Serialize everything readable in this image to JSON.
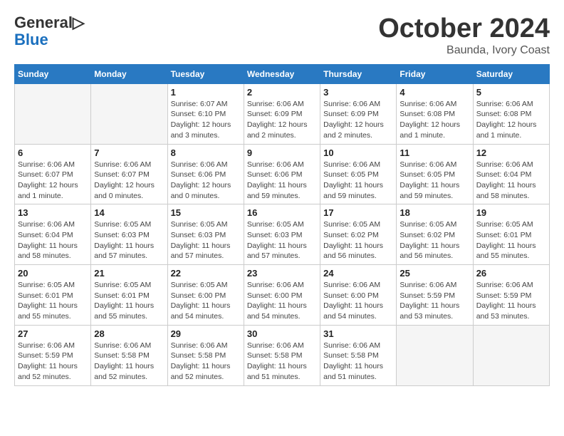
{
  "header": {
    "logo_general": "General",
    "logo_blue": "Blue",
    "month": "October 2024",
    "location": "Baunda, Ivory Coast"
  },
  "weekdays": [
    "Sunday",
    "Monday",
    "Tuesday",
    "Wednesday",
    "Thursday",
    "Friday",
    "Saturday"
  ],
  "weeks": [
    [
      {
        "day": "",
        "empty": true
      },
      {
        "day": "",
        "empty": true
      },
      {
        "day": "1",
        "sunrise": "Sunrise: 6:07 AM",
        "sunset": "Sunset: 6:10 PM",
        "daylight": "Daylight: 12 hours and 3 minutes."
      },
      {
        "day": "2",
        "sunrise": "Sunrise: 6:06 AM",
        "sunset": "Sunset: 6:09 PM",
        "daylight": "Daylight: 12 hours and 2 minutes."
      },
      {
        "day": "3",
        "sunrise": "Sunrise: 6:06 AM",
        "sunset": "Sunset: 6:09 PM",
        "daylight": "Daylight: 12 hours and 2 minutes."
      },
      {
        "day": "4",
        "sunrise": "Sunrise: 6:06 AM",
        "sunset": "Sunset: 6:08 PM",
        "daylight": "Daylight: 12 hours and 1 minute."
      },
      {
        "day": "5",
        "sunrise": "Sunrise: 6:06 AM",
        "sunset": "Sunset: 6:08 PM",
        "daylight": "Daylight: 12 hours and 1 minute."
      }
    ],
    [
      {
        "day": "6",
        "sunrise": "Sunrise: 6:06 AM",
        "sunset": "Sunset: 6:07 PM",
        "daylight": "Daylight: 12 hours and 1 minute."
      },
      {
        "day": "7",
        "sunrise": "Sunrise: 6:06 AM",
        "sunset": "Sunset: 6:07 PM",
        "daylight": "Daylight: 12 hours and 0 minutes."
      },
      {
        "day": "8",
        "sunrise": "Sunrise: 6:06 AM",
        "sunset": "Sunset: 6:06 PM",
        "daylight": "Daylight: 12 hours and 0 minutes."
      },
      {
        "day": "9",
        "sunrise": "Sunrise: 6:06 AM",
        "sunset": "Sunset: 6:06 PM",
        "daylight": "Daylight: 11 hours and 59 minutes."
      },
      {
        "day": "10",
        "sunrise": "Sunrise: 6:06 AM",
        "sunset": "Sunset: 6:05 PM",
        "daylight": "Daylight: 11 hours and 59 minutes."
      },
      {
        "day": "11",
        "sunrise": "Sunrise: 6:06 AM",
        "sunset": "Sunset: 6:05 PM",
        "daylight": "Daylight: 11 hours and 59 minutes."
      },
      {
        "day": "12",
        "sunrise": "Sunrise: 6:06 AM",
        "sunset": "Sunset: 6:04 PM",
        "daylight": "Daylight: 11 hours and 58 minutes."
      }
    ],
    [
      {
        "day": "13",
        "sunrise": "Sunrise: 6:06 AM",
        "sunset": "Sunset: 6:04 PM",
        "daylight": "Daylight: 11 hours and 58 minutes."
      },
      {
        "day": "14",
        "sunrise": "Sunrise: 6:05 AM",
        "sunset": "Sunset: 6:03 PM",
        "daylight": "Daylight: 11 hours and 57 minutes."
      },
      {
        "day": "15",
        "sunrise": "Sunrise: 6:05 AM",
        "sunset": "Sunset: 6:03 PM",
        "daylight": "Daylight: 11 hours and 57 minutes."
      },
      {
        "day": "16",
        "sunrise": "Sunrise: 6:05 AM",
        "sunset": "Sunset: 6:03 PM",
        "daylight": "Daylight: 11 hours and 57 minutes."
      },
      {
        "day": "17",
        "sunrise": "Sunrise: 6:05 AM",
        "sunset": "Sunset: 6:02 PM",
        "daylight": "Daylight: 11 hours and 56 minutes."
      },
      {
        "day": "18",
        "sunrise": "Sunrise: 6:05 AM",
        "sunset": "Sunset: 6:02 PM",
        "daylight": "Daylight: 11 hours and 56 minutes."
      },
      {
        "day": "19",
        "sunrise": "Sunrise: 6:05 AM",
        "sunset": "Sunset: 6:01 PM",
        "daylight": "Daylight: 11 hours and 55 minutes."
      }
    ],
    [
      {
        "day": "20",
        "sunrise": "Sunrise: 6:05 AM",
        "sunset": "Sunset: 6:01 PM",
        "daylight": "Daylight: 11 hours and 55 minutes."
      },
      {
        "day": "21",
        "sunrise": "Sunrise: 6:05 AM",
        "sunset": "Sunset: 6:01 PM",
        "daylight": "Daylight: 11 hours and 55 minutes."
      },
      {
        "day": "22",
        "sunrise": "Sunrise: 6:05 AM",
        "sunset": "Sunset: 6:00 PM",
        "daylight": "Daylight: 11 hours and 54 minutes."
      },
      {
        "day": "23",
        "sunrise": "Sunrise: 6:06 AM",
        "sunset": "Sunset: 6:00 PM",
        "daylight": "Daylight: 11 hours and 54 minutes."
      },
      {
        "day": "24",
        "sunrise": "Sunrise: 6:06 AM",
        "sunset": "Sunset: 6:00 PM",
        "daylight": "Daylight: 11 hours and 54 minutes."
      },
      {
        "day": "25",
        "sunrise": "Sunrise: 6:06 AM",
        "sunset": "Sunset: 5:59 PM",
        "daylight": "Daylight: 11 hours and 53 minutes."
      },
      {
        "day": "26",
        "sunrise": "Sunrise: 6:06 AM",
        "sunset": "Sunset: 5:59 PM",
        "daylight": "Daylight: 11 hours and 53 minutes."
      }
    ],
    [
      {
        "day": "27",
        "sunrise": "Sunrise: 6:06 AM",
        "sunset": "Sunset: 5:59 PM",
        "daylight": "Daylight: 11 hours and 52 minutes."
      },
      {
        "day": "28",
        "sunrise": "Sunrise: 6:06 AM",
        "sunset": "Sunset: 5:58 PM",
        "daylight": "Daylight: 11 hours and 52 minutes."
      },
      {
        "day": "29",
        "sunrise": "Sunrise: 6:06 AM",
        "sunset": "Sunset: 5:58 PM",
        "daylight": "Daylight: 11 hours and 52 minutes."
      },
      {
        "day": "30",
        "sunrise": "Sunrise: 6:06 AM",
        "sunset": "Sunset: 5:58 PM",
        "daylight": "Daylight: 11 hours and 51 minutes."
      },
      {
        "day": "31",
        "sunrise": "Sunrise: 6:06 AM",
        "sunset": "Sunset: 5:58 PM",
        "daylight": "Daylight: 11 hours and 51 minutes."
      },
      {
        "day": "",
        "empty": true
      },
      {
        "day": "",
        "empty": true
      }
    ]
  ]
}
